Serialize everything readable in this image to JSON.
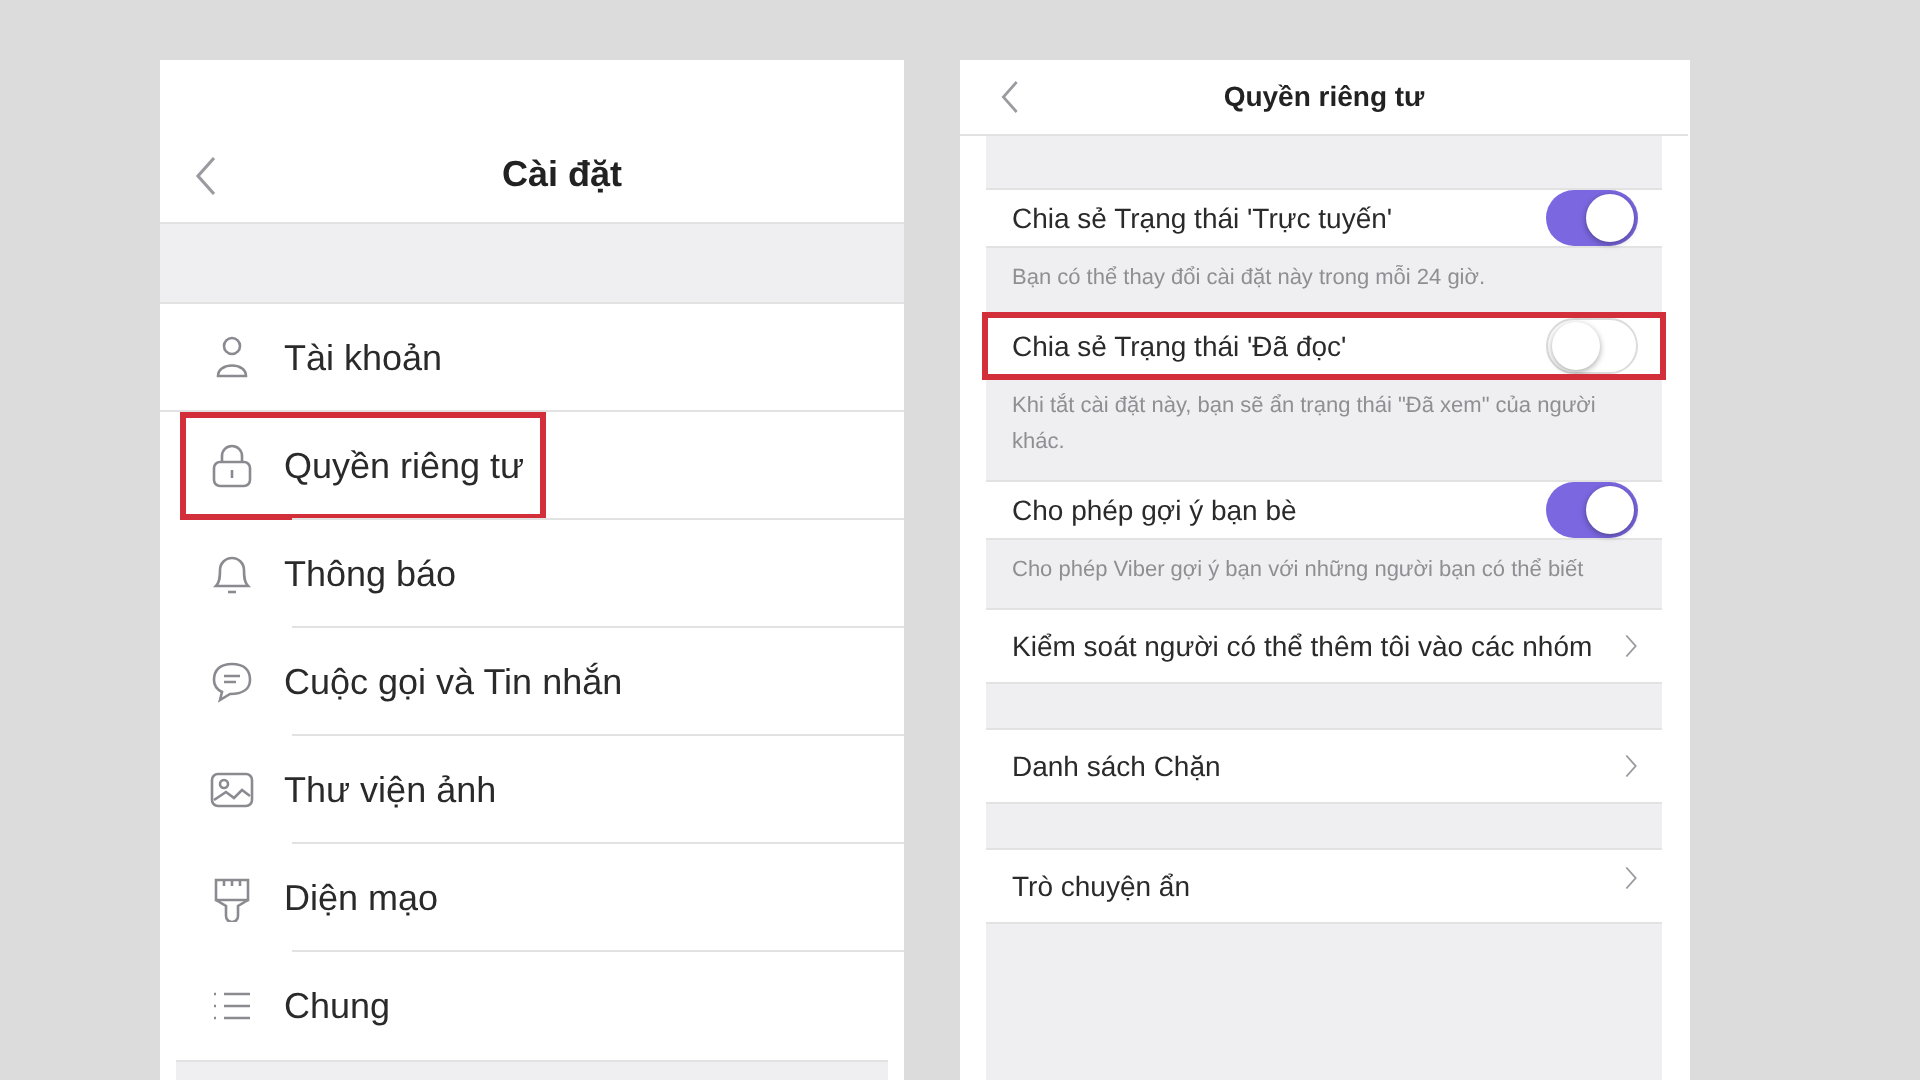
{
  "settings_screen": {
    "title": "Cài đặt",
    "items": [
      {
        "kind": "account",
        "label": "Tài khoản",
        "highlighted": false
      },
      {
        "kind": "privacy",
        "label": "Quyền riêng tư",
        "highlighted": true
      },
      {
        "kind": "notifications",
        "label": "Thông báo",
        "highlighted": false
      },
      {
        "kind": "calls",
        "label": "Cuộc gọi và Tin nhắn",
        "highlighted": false
      },
      {
        "kind": "media",
        "label": "Thư viện ảnh",
        "highlighted": false
      },
      {
        "kind": "appearance",
        "label": "Diện mạo",
        "highlighted": false
      },
      {
        "kind": "general",
        "label": "Chung",
        "highlighted": false
      }
    ]
  },
  "privacy_screen": {
    "title": "Quyền riêng tư",
    "sections": [
      {
        "row": {
          "kind": "toggle",
          "label": "Chia sẻ Trạng thái 'Trực tuyến'",
          "on": true,
          "highlighted": false
        },
        "note": "Bạn có thể thay đổi cài đặt này trong mỗi 24 giờ."
      },
      {
        "row": {
          "kind": "toggle",
          "label": "Chia sẻ Trạng thái 'Đã đọc'",
          "on": false,
          "highlighted": true
        },
        "note": "Khi tắt cài đặt này, bạn sẽ ẩn trạng thái \"Đã xem\" của người khác."
      },
      {
        "row": {
          "kind": "toggle",
          "label": "Cho phép gợi ý bạn bè",
          "on": true,
          "highlighted": false
        },
        "note": "Cho phép Viber gợi ý bạn với những người bạn có thể biết"
      },
      {
        "row": {
          "kind": "link",
          "label": "Kiểm soát người có thể thêm tôi vào các nhóm",
          "highlighted": false
        }
      },
      {
        "row": {
          "kind": "link",
          "label": "Danh sách Chặn",
          "highlighted": false
        }
      },
      {
        "row": {
          "kind": "link",
          "label": "Trò chuyện ẩn",
          "highlighted": false
        }
      }
    ]
  }
}
